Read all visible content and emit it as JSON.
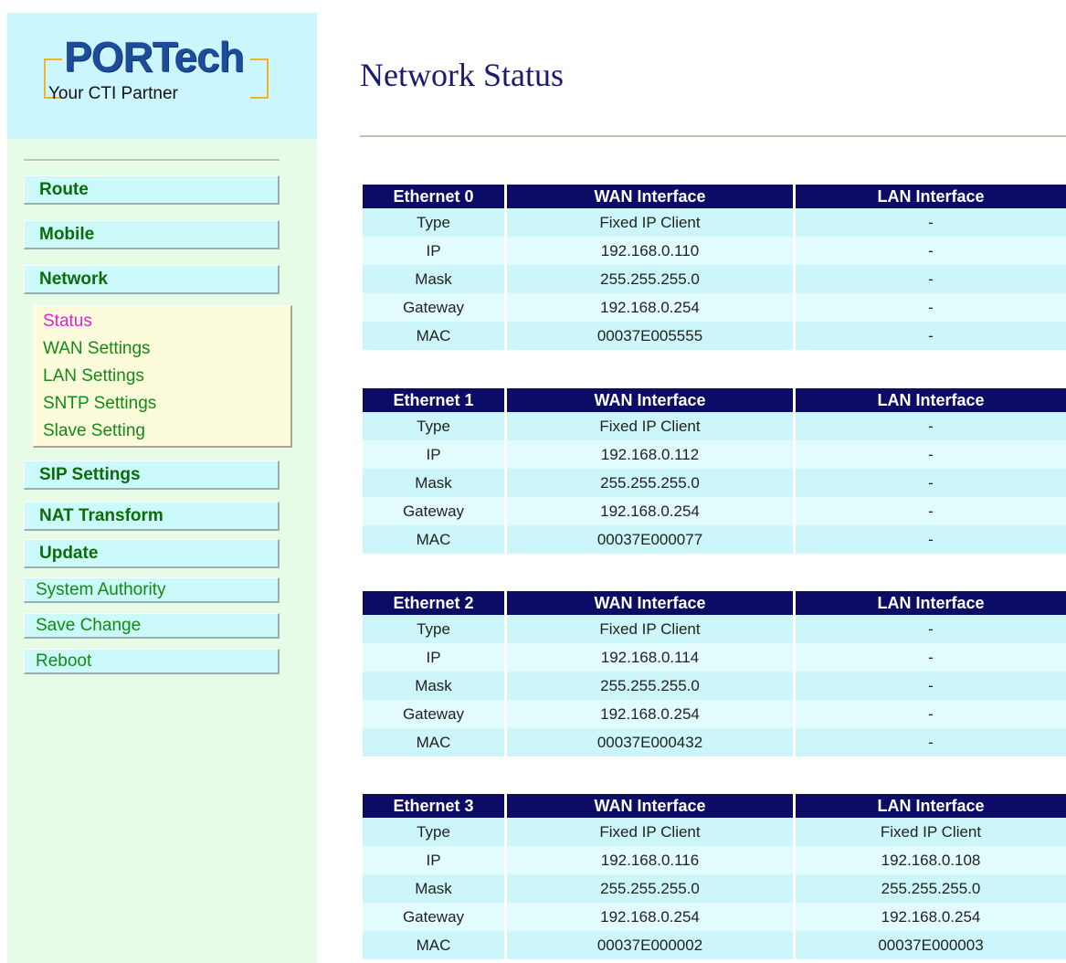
{
  "logo": {
    "main": "PORTech",
    "tagline": "Your CTI Partner"
  },
  "sidebar": {
    "items": [
      {
        "label": "Route"
      },
      {
        "label": "Mobile"
      },
      {
        "label": "Network"
      },
      {
        "label": "SIP Settings"
      },
      {
        "label": "NAT Transform"
      },
      {
        "label": "Update"
      },
      {
        "label": "System Authority"
      },
      {
        "label": "Save Change"
      },
      {
        "label": "Reboot"
      }
    ],
    "network_subitems": [
      {
        "label": "Status",
        "active": true
      },
      {
        "label": "WAN Settings"
      },
      {
        "label": "LAN Settings"
      },
      {
        "label": "SNTP Settings"
      },
      {
        "label": "Slave Setting"
      }
    ]
  },
  "page": {
    "title": "Network Status"
  },
  "colors": {
    "header_bg": "#0c0c66",
    "row_a": "#ccf6fa",
    "row_b": "#e2fcfe",
    "active_link": "#e020d0",
    "link": "#138a13"
  },
  "tables": [
    {
      "headers": [
        "Ethernet 0",
        "WAN Interface",
        "LAN Interface"
      ],
      "rows": [
        [
          "Type",
          "Fixed IP Client",
          "-"
        ],
        [
          "IP",
          "192.168.0.110",
          "-"
        ],
        [
          "Mask",
          "255.255.255.0",
          "-"
        ],
        [
          "Gateway",
          "192.168.0.254",
          "-"
        ],
        [
          "MAC",
          "00037E005555",
          "-"
        ]
      ]
    },
    {
      "headers": [
        "Ethernet 1",
        "WAN Interface",
        "LAN Interface"
      ],
      "rows": [
        [
          "Type",
          "Fixed IP Client",
          "-"
        ],
        [
          "IP",
          "192.168.0.112",
          "-"
        ],
        [
          "Mask",
          "255.255.255.0",
          "-"
        ],
        [
          "Gateway",
          "192.168.0.254",
          "-"
        ],
        [
          "MAC",
          "00037E000077",
          "-"
        ]
      ]
    },
    {
      "headers": [
        "Ethernet 2",
        "WAN Interface",
        "LAN Interface"
      ],
      "rows": [
        [
          "Type",
          "Fixed IP Client",
          "-"
        ],
        [
          "IP",
          "192.168.0.114",
          "-"
        ],
        [
          "Mask",
          "255.255.255.0",
          "-"
        ],
        [
          "Gateway",
          "192.168.0.254",
          "-"
        ],
        [
          "MAC",
          "00037E000432",
          "-"
        ]
      ]
    },
    {
      "headers": [
        "Ethernet 3",
        "WAN Interface",
        "LAN Interface"
      ],
      "rows": [
        [
          "Type",
          "Fixed IP Client",
          "Fixed IP Client"
        ],
        [
          "IP",
          "192.168.0.116",
          "192.168.0.108"
        ],
        [
          "Mask",
          "255.255.255.0",
          "255.255.255.0"
        ],
        [
          "Gateway",
          "192.168.0.254",
          "192.168.0.254"
        ],
        [
          "MAC",
          "00037E000002",
          "00037E000003"
        ]
      ]
    }
  ]
}
